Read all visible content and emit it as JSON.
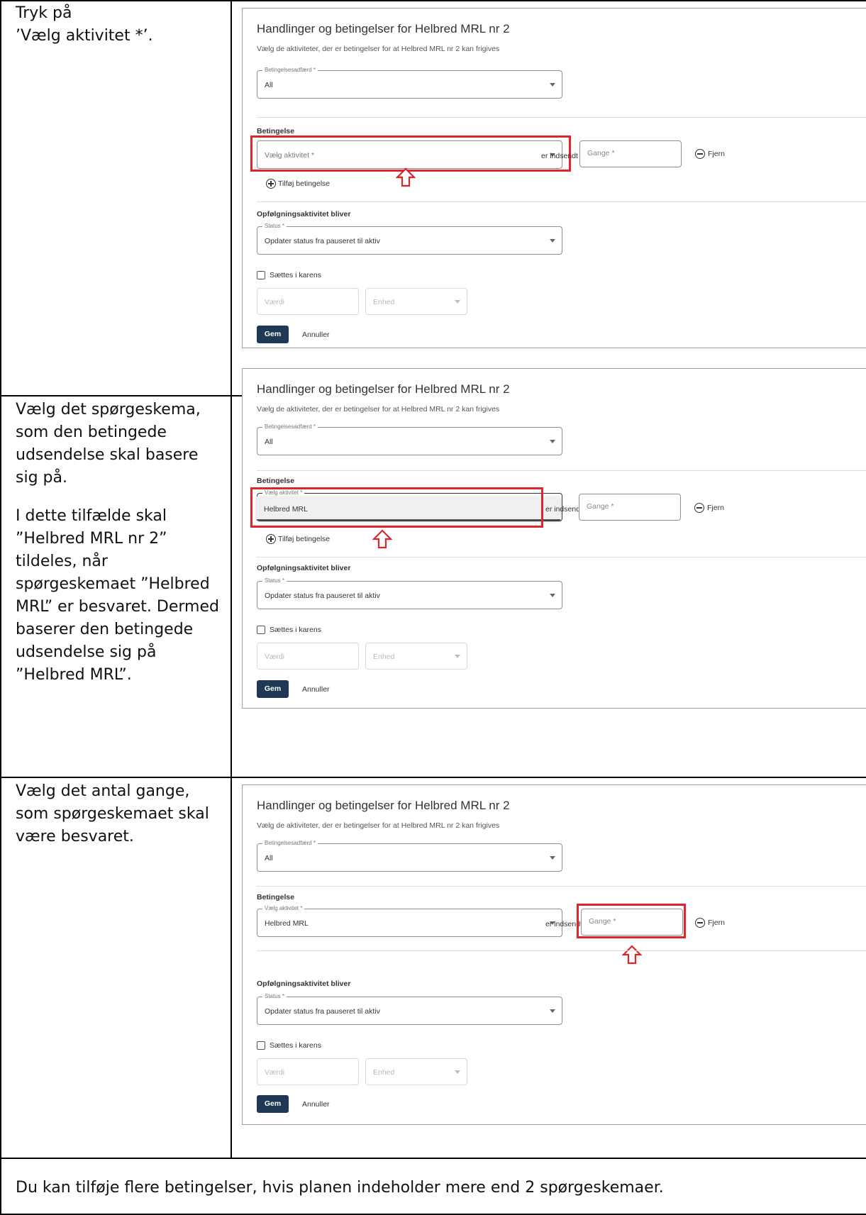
{
  "rows": [
    {
      "instruction": [
        "Tryk på",
        "’Vælg aktivitet *’."
      ]
    },
    {
      "instruction": [
        "Vælg det spørgeskema, som den betingede udsendelse skal basere sig på.",
        "I dette tilfælde skal ”Helbred MRL nr 2” tildeles, når spørgeskemaet ”Helbred MRL” er besvaret. Dermed baserer den betingede udsendelse sig på ”Helbred MRL”."
      ]
    },
    {
      "instruction": [
        "Vælg det antal gange, som spørgeskemaet skal være besvaret."
      ]
    }
  ],
  "footer": "Du kan tilføje flere betingelser, hvis planen indeholder mere end 2 spørgeskemaer.",
  "panel": {
    "title": "Handlinger og betingelser for Helbred MRL nr 2",
    "subtitle": "Vælg de aktiviteter, der er betingelser for at Helbred MRL nr 2 kan frigives",
    "behavior_label": "Betingelsesadfærd *",
    "behavior_value": "All",
    "condition_heading": "Betingelse",
    "activity_placeholder": "Vælg aktivitet *",
    "activity_label": "Vælg aktivitet *",
    "activity_option": "Helbred MRL",
    "activity_value": "Helbred MRL",
    "submitted_text": "er indsendt",
    "count_placeholder": "Gange *",
    "remove_label": "Fjern",
    "add_condition_label": "Tilføj betingelse",
    "followup_heading": "Opfølgningsaktivitet bliver",
    "status_label": "Status *",
    "status_value": "Opdater status fra pauseret til aktiv",
    "karens_label": "Sættes i karens",
    "value_placeholder": "Værdi",
    "unit_placeholder": "Enhed",
    "save_label": "Gem",
    "cancel_label": "Annuller"
  },
  "colors": {
    "highlight": "#e0242b",
    "primary_button": "#1f3855"
  }
}
